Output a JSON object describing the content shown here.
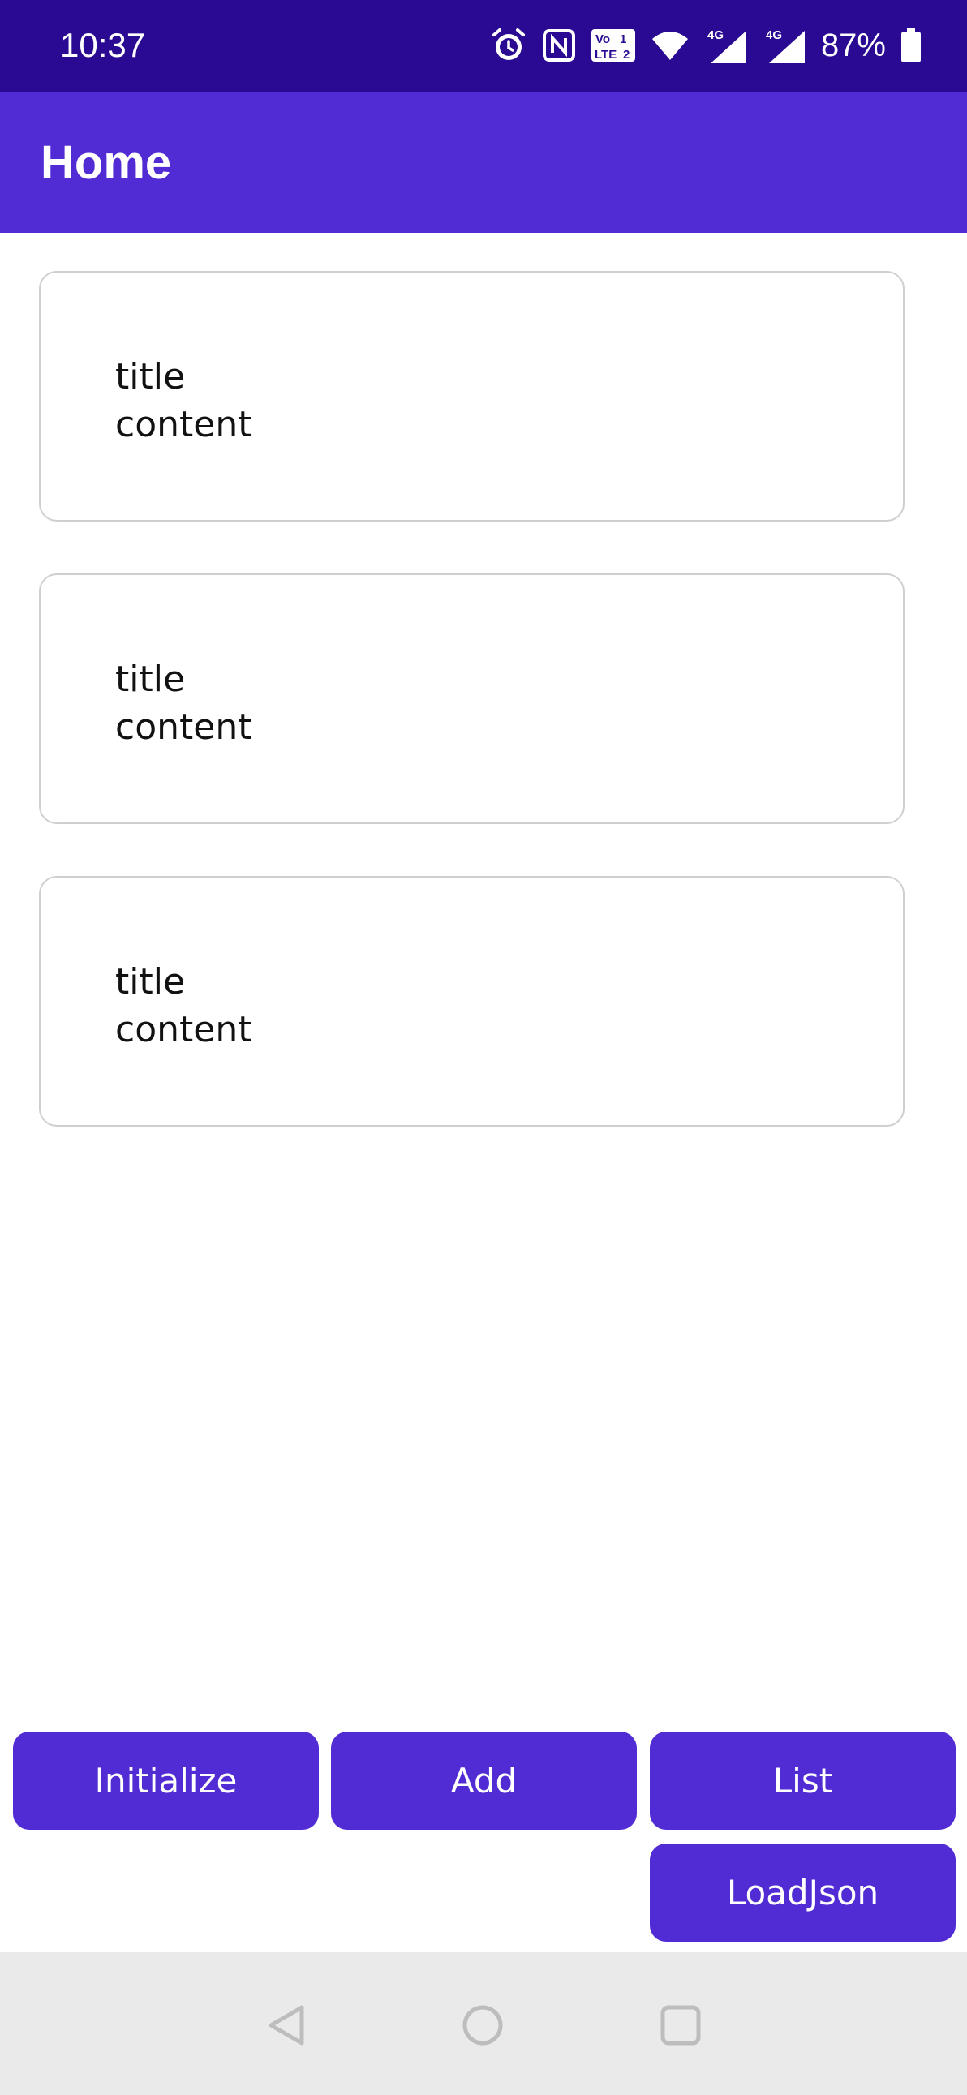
{
  "status_bar": {
    "time": "10:37",
    "battery_percent": "87%",
    "icons": [
      "alarm-icon",
      "nfc-icon",
      "volte-icon",
      "wifi-icon",
      "signal-4g-icon",
      "signal-4g-icon",
      "battery-icon"
    ],
    "network_label_1": "4G",
    "network_label_2": "4G",
    "volte_label": "LTE"
  },
  "app_bar": {
    "title": "Home"
  },
  "cards": [
    {
      "title": "title",
      "content": "content"
    },
    {
      "title": "title",
      "content": "content"
    },
    {
      "title": "title",
      "content": "content"
    }
  ],
  "buttons": {
    "initialize": "Initialize",
    "add": "Add",
    "list": "List",
    "load_json": "LoadJson"
  },
  "nav_bar": {
    "icons": [
      "back-icon",
      "home-icon",
      "recents-icon"
    ]
  },
  "colors": {
    "status_bar": "#2a0a93",
    "primary": "#512bd4",
    "nav_bar": "#eaeaea"
  }
}
